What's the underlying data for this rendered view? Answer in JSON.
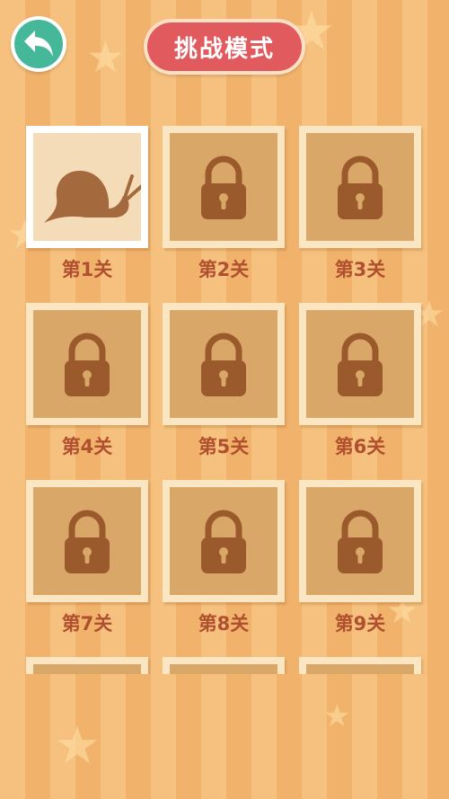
{
  "header": {
    "back_icon": "back-arrow-icon",
    "title": "挑战模式"
  },
  "colors": {
    "background": "#f6c17e",
    "back_button": "#45b89a",
    "title_pill": "#e05a5e",
    "tile_locked": "#d9a767",
    "tile_unlocked": "#f5dcb8",
    "label": "#b0502f"
  },
  "levels": [
    {
      "label": "第1关",
      "locked": false,
      "icon": "snail-icon"
    },
    {
      "label": "第2关",
      "locked": true,
      "icon": "lock-icon"
    },
    {
      "label": "第3关",
      "locked": true,
      "icon": "lock-icon"
    },
    {
      "label": "第4关",
      "locked": true,
      "icon": "lock-icon"
    },
    {
      "label": "第5关",
      "locked": true,
      "icon": "lock-icon"
    },
    {
      "label": "第6关",
      "locked": true,
      "icon": "lock-icon"
    },
    {
      "label": "第7关",
      "locked": true,
      "icon": "lock-icon"
    },
    {
      "label": "第8关",
      "locked": true,
      "icon": "lock-icon"
    },
    {
      "label": "第9关",
      "locked": true,
      "icon": "lock-icon"
    },
    {
      "label": "",
      "locked": true,
      "icon": "lock-icon"
    },
    {
      "label": "",
      "locked": true,
      "icon": "lock-icon"
    },
    {
      "label": "",
      "locked": true,
      "icon": "lock-icon"
    }
  ]
}
